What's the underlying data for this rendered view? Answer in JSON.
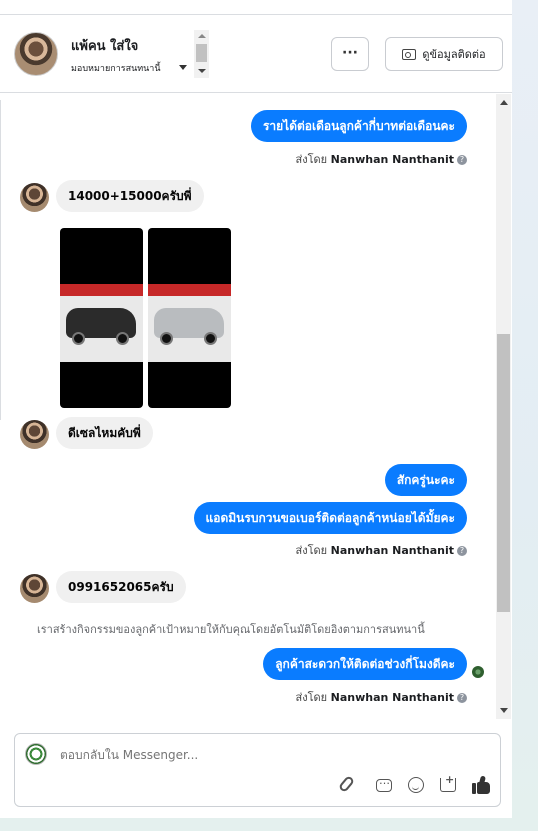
{
  "header": {
    "name": "แพ้คน ใส่ใจ",
    "assign_label": "มอบหมายการสนทนานี้",
    "more_label": "···",
    "contact_label": "ดูข้อมูลติดต่อ"
  },
  "messages": {
    "m1": "รายได้ต่อเดือนลูกค้ากี่บาทต่อเดือนคะ",
    "m2": "14000+15000ครับพี่",
    "m3": "ดีเซลไหมคับพี่",
    "m4": "สักครู่นะคะ",
    "m5": "แอดมินรบกวนขอเบอร์ติดต่อลูกค้าหน่อยได้มั้ยคะ",
    "m6": "0991652065ครับ",
    "m7": "ลูกค้าสะดวกให้ติดต่อช่วงกี่โมงดีคะ"
  },
  "sent_by": {
    "prefix": "ส่งโดย",
    "agent": "Nanwhan Nanthanit"
  },
  "system_note": "เราสร้างกิจกรรมของลูกค้าเป้าหมายให้กับคุณโดยอัตโนมัติโดยอิงตามการสนทนานี้",
  "composer": {
    "placeholder": "ตอบกลับใน Messenger..."
  },
  "icons": {
    "attach": "paperclip-icon",
    "saved_reply": "chat-bubble-icon",
    "emoji": "smile-icon",
    "add_to_cart": "cart-plus-icon",
    "like": "thumbs-up-icon"
  },
  "colors": {
    "outgoing": "#0a7cff",
    "incoming": "#f0f0f0"
  }
}
